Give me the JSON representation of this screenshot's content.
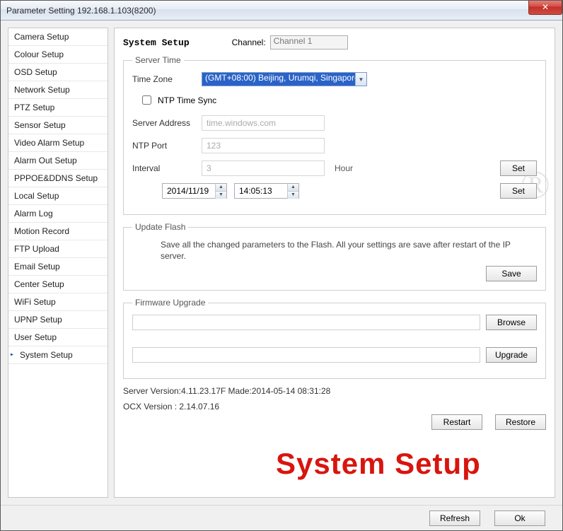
{
  "window": {
    "title": "Parameter Setting 192.168.1.103(8200)",
    "close_glyph": "✕"
  },
  "sidebar": {
    "items": [
      "Camera Setup",
      "Colour Setup",
      "OSD Setup",
      "Network Setup",
      "PTZ Setup",
      "Sensor Setup",
      "Video Alarm Setup",
      "Alarm Out Setup",
      "PPPOE&DDNS Setup",
      "Local Setup",
      "Alarm Log",
      "Motion Record",
      "FTP Upload",
      "Email Setup",
      "Center Setup",
      "WiFi Setup",
      "UPNP Setup",
      "User Setup",
      "System Setup"
    ],
    "active_index": 18
  },
  "main": {
    "title": "System Setup",
    "channel_label": "Channel:",
    "channel_value": "Channel 1",
    "server_time": {
      "legend": "Server Time",
      "tz_label": "Time Zone",
      "tz_value": "(GMT+08:00) Beijing, Urumqi, Singapore",
      "ntp_sync_label": "NTP Time Sync",
      "ntp_sync_checked": false,
      "server_addr_label": "Server Address",
      "server_addr_value": "time.windows.com",
      "ntp_port_label": "NTP Port",
      "ntp_port_value": "123",
      "interval_label": "Interval",
      "interval_value": "3",
      "hour_label": "Hour",
      "set1_btn": "Set",
      "date_value": "2014/11/19",
      "time_value": "14:05:13",
      "set2_btn": "Set"
    },
    "update_flash": {
      "legend": "Update Flash",
      "text": "Save all the changed parameters to the Flash. All your settings are save after restart of the IP server.",
      "save_btn": "Save"
    },
    "firmware": {
      "legend": "Firmware Upgrade",
      "browse_btn": "Browse",
      "upgrade_btn": "Upgrade"
    },
    "versions": {
      "server": "Server Version:4.11.23.17F Made:2014-05-14 08:31:28",
      "ocx": "OCX Version : 2.14.07.16"
    },
    "restart_btn": "Restart",
    "restore_btn": "Restore",
    "overlay_text": "System Setup"
  },
  "footer": {
    "refresh_btn": "Refresh",
    "ok_btn": "Ok"
  },
  "watermark": {
    "r": "®"
  }
}
